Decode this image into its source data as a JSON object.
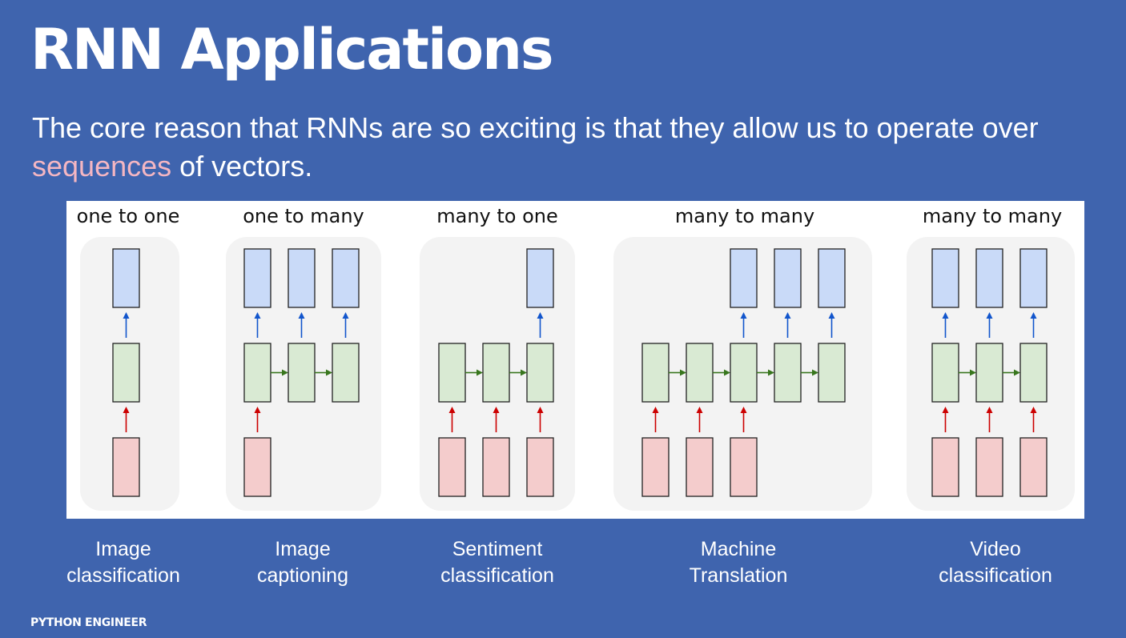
{
  "slide": {
    "title": "RNN Applications",
    "subtitle_before": "The core reason that RNNs are so exciting is that they allow us to operate over ",
    "subtitle_highlight": "sequences",
    "subtitle_after": " of vectors.",
    "footer": "PYTHON ENGINEER"
  },
  "colors": {
    "background": "#3f64ae",
    "highlight": "#f4b6c2",
    "input_box": "#f4cccc",
    "hidden_box": "#d9ead3",
    "output_box": "#c9daf8",
    "input_arrow": "#cc0000",
    "hidden_arrow": "#38761d",
    "output_arrow": "#1155cc"
  },
  "panels": [
    {
      "label": "one to one",
      "caption_line1": "Image",
      "caption_line2": "classification",
      "steps": 1,
      "inputs": [
        0
      ],
      "outputs": [
        0
      ]
    },
    {
      "label": "one to many",
      "caption_line1": "Image",
      "caption_line2": "captioning",
      "steps": 3,
      "inputs": [
        0
      ],
      "outputs": [
        0,
        1,
        2
      ]
    },
    {
      "label": "many to one",
      "caption_line1": "Sentiment",
      "caption_line2": "classification",
      "steps": 3,
      "inputs": [
        0,
        1,
        2
      ],
      "outputs": [
        2
      ]
    },
    {
      "label": "many to many",
      "caption_line1": "Machine",
      "caption_line2": "Translation",
      "steps": 5,
      "inputs": [
        0,
        1,
        2
      ],
      "outputs": [
        2,
        3,
        4
      ]
    },
    {
      "label": "many to many",
      "caption_line1": "Video",
      "caption_line2": "classification",
      "steps": 3,
      "inputs": [
        0,
        1,
        2
      ],
      "outputs": [
        0,
        1,
        2
      ]
    }
  ]
}
